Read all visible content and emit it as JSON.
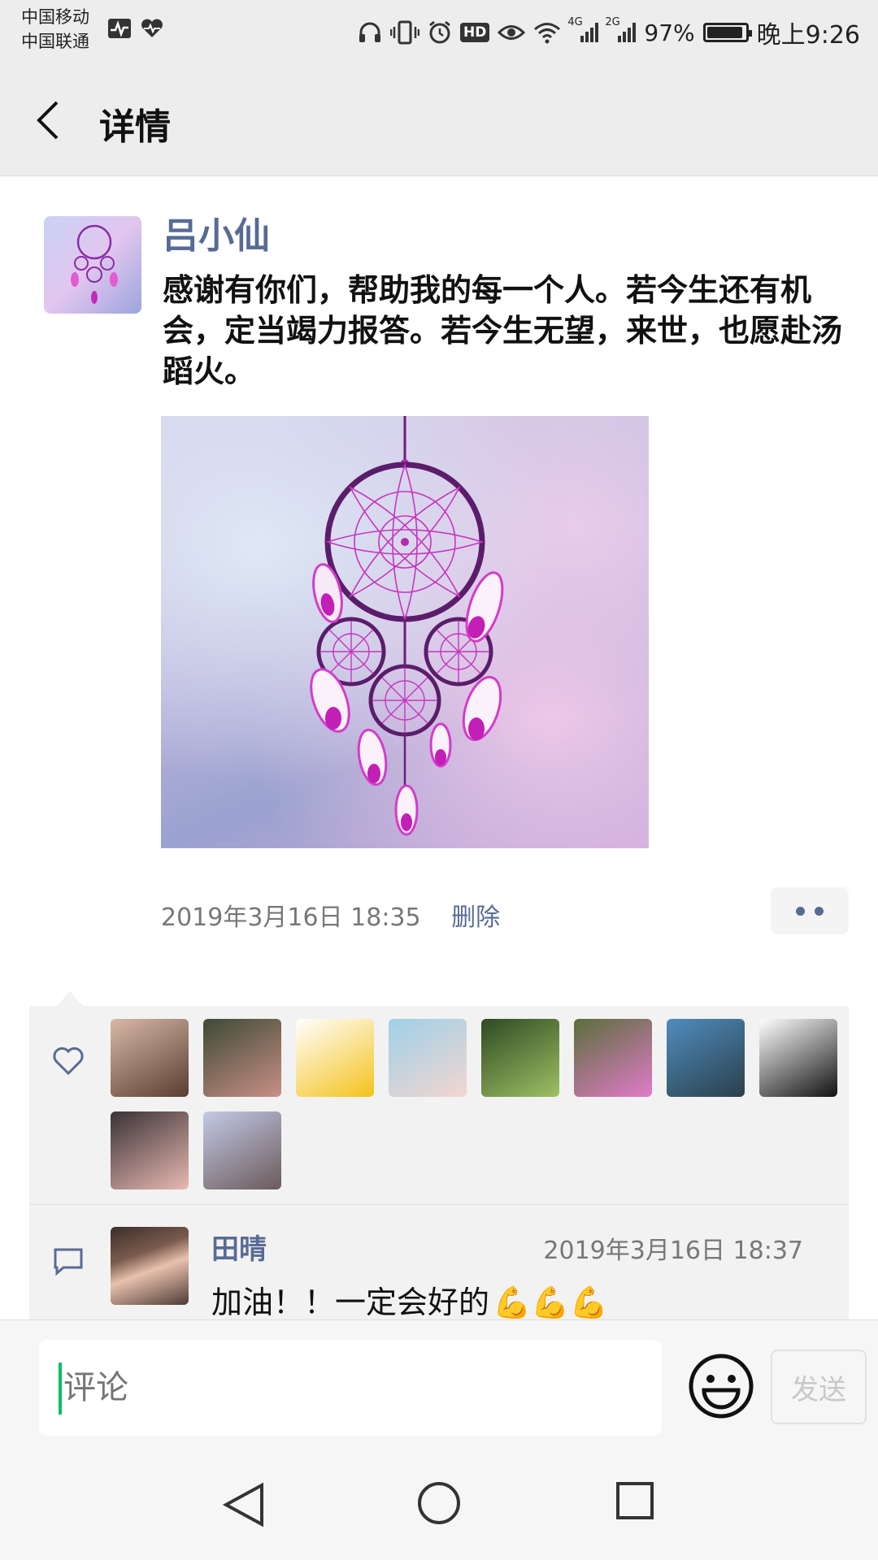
{
  "status_bar": {
    "carrier_1": "中国移动",
    "carrier_2": "中国联通",
    "network_1": "4G",
    "network_2": "2G",
    "hd": "HD",
    "battery": "97%",
    "battery_level": 0.97,
    "time": "晚上9:26",
    "icons": [
      "activity-icon",
      "heart-rate-icon",
      "headphones-icon",
      "vibrate-icon",
      "alarm-icon",
      "hd-icon",
      "eye-icon",
      "wifi-icon",
      "signal-icon",
      "signal-icon",
      "battery-icon"
    ]
  },
  "nav": {
    "title": "详情",
    "back_icon": "back-arrow-icon"
  },
  "post": {
    "author": "吕小仙",
    "text": "感谢有你们，帮助我的每一个人。若今生还有机会，定当竭力报答。若今生无望，来世，也愿赴汤蹈火。",
    "time": "2019年3月16日 18:35",
    "delete_label": "删除",
    "image": "dreamcatcher-image"
  },
  "likes": {
    "icon": "heart-outline-icon",
    "likers": [
      {
        "name": "liker-1",
        "colors": [
          "#d8b9a8",
          "#5a3d31"
        ]
      },
      {
        "name": "liker-2",
        "colors": [
          "#3d4a35",
          "#c98f86"
        ]
      },
      {
        "name": "liker-3",
        "colors": [
          "#ffffff",
          "#f4c21a"
        ]
      },
      {
        "name": "liker-4",
        "colors": [
          "#9fd0e8",
          "#f2d6d0"
        ]
      },
      {
        "name": "liker-5",
        "colors": [
          "#2e4a24",
          "#9ec063"
        ]
      },
      {
        "name": "liker-6",
        "colors": [
          "#5a6e3b",
          "#e27bc9"
        ]
      },
      {
        "name": "liker-7",
        "colors": [
          "#4f8dbd",
          "#2b3f4a"
        ]
      },
      {
        "name": "liker-8",
        "colors": [
          "#ffffff",
          "#111111"
        ]
      },
      {
        "name": "liker-9",
        "colors": [
          "#3a3236",
          "#e8b9b2"
        ]
      },
      {
        "name": "liker-10",
        "colors": [
          "#c3c9e6",
          "#6b5a5a"
        ]
      }
    ]
  },
  "comments": [
    {
      "name": "田晴",
      "time": "2019年3月16日 18:37",
      "text": "加油！！一定会好的",
      "emoji": "💪💪💪"
    }
  ],
  "input": {
    "placeholder": "评论",
    "emoji_icon": "smiley-icon",
    "send_label": "发送"
  },
  "colors": {
    "link": "#576b95",
    "accent": "#07c160",
    "panel": "#f2f2f2"
  }
}
